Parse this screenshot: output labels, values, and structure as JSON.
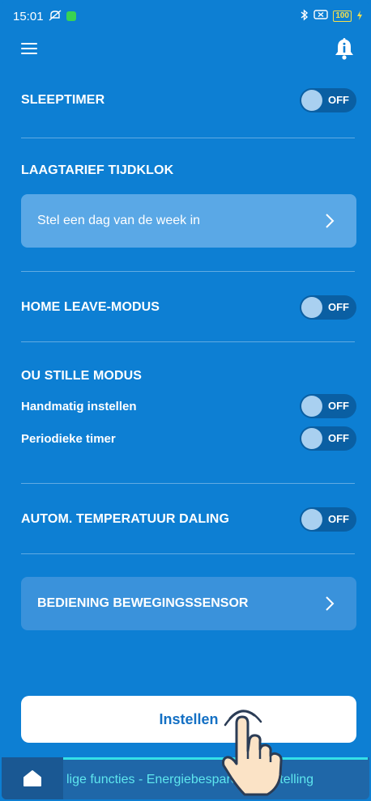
{
  "status_bar": {
    "time": "15:01",
    "battery": "100"
  },
  "header": {
    "menu_icon": "hamburger-icon",
    "bell_icon": "bell-info-icon"
  },
  "sleeptimer": {
    "label": "SLEEPTIMER",
    "state": "OFF"
  },
  "laagtarief": {
    "label": "LAAGTARIEF TIJDKLOK",
    "card_text": "Stel een dag van de week in"
  },
  "home_leave": {
    "label": "HOME LEAVE-MODUS",
    "state": "OFF"
  },
  "ou_stille": {
    "label": "OU STILLE MODUS",
    "manual_label": "Handmatig instellen",
    "manual_state": "OFF",
    "periodic_label": "Periodieke timer",
    "periodic_state": "OFF"
  },
  "autom_temp": {
    "label": "AUTOM. TEMPERATUUR DALING",
    "state": "OFF"
  },
  "motion_sensor": {
    "card_text": "BEDIENING BEWEGINGSSENSOR"
  },
  "action": {
    "button_label": "Instellen"
  },
  "bottom_nav": {
    "ticker": "lige functies - Energiebesparende instelling"
  },
  "colors": {
    "background": "#0d7fd3",
    "card": "#5aa8e6",
    "toggle_track": "#0a5fa3",
    "toggle_knob": "#a9d0f0",
    "ticker_accent": "#34e0e8"
  }
}
